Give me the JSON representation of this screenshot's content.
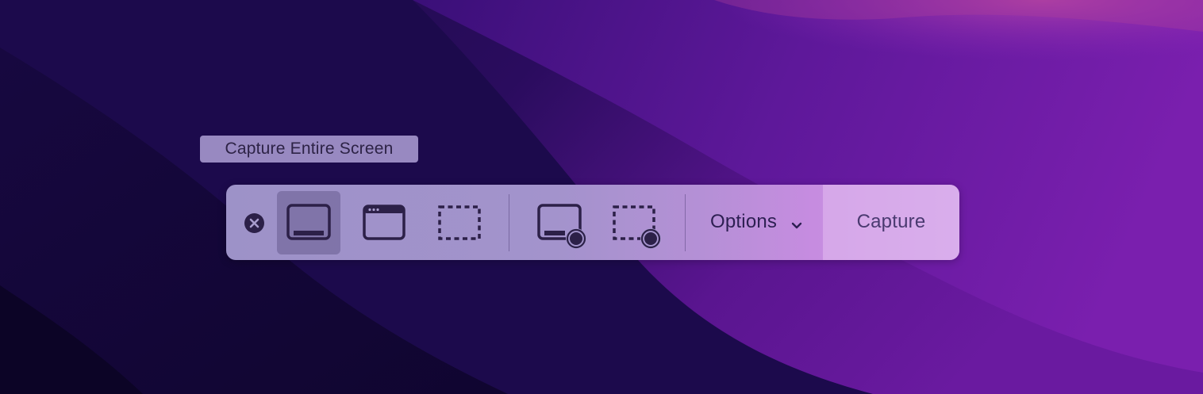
{
  "tooltip": {
    "text": "Capture Entire Screen"
  },
  "toolbar": {
    "close_icon": "close-icon",
    "modes": [
      {
        "name": "capture-entire-screen",
        "icon": "entire-screen-icon",
        "selected": true
      },
      {
        "name": "capture-selected-window",
        "icon": "window-icon",
        "selected": false
      },
      {
        "name": "capture-selected-portion",
        "icon": "dashed-selection-icon",
        "selected": false
      },
      {
        "name": "record-entire-screen",
        "icon": "record-screen-icon",
        "selected": false
      },
      {
        "name": "record-selected-portion",
        "icon": "record-selection-icon",
        "selected": false
      }
    ],
    "options_label": "Options",
    "options_icon": "chevron-down-icon",
    "capture_label": "Capture"
  },
  "colors": {
    "toolbar_icon": "#2c2048",
    "wallpaper_dark": "#140838",
    "wallpaper_purple": "#6a1a9e"
  }
}
